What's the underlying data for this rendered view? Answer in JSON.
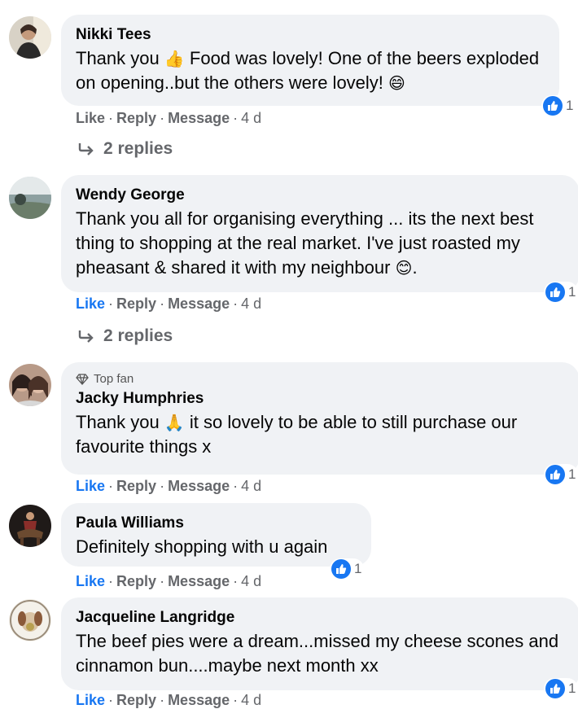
{
  "comments": [
    {
      "name": "Nikki Tees",
      "text_a": "Thank you",
      "emoji_a": "👍",
      "text_b": "Food was lovely! One of the beers exploded on opening..but the others were lovely!",
      "emoji_b": "😄",
      "reactions": "1",
      "like": "Like",
      "reply": "Reply",
      "message": "Message",
      "time": "4 d",
      "replies": "2 replies"
    },
    {
      "name": "Wendy George",
      "text_a": "Thank you all for organising everything ... its the next best thing to shopping at the real market. I've just roasted my pheasant & shared it with my neighbour",
      "emoji_a": "😊",
      "text_b": ".",
      "reactions": "1",
      "like": "Like",
      "reply": "Reply",
      "message": "Message",
      "time": "4 d",
      "replies": "2 replies"
    },
    {
      "badge": "Top fan",
      "name": "Jacky Humphries",
      "text_a": "Thank you",
      "emoji_a": "🙏",
      "text_b": "it so lovely to be able to still purchase our favourite things x",
      "reactions": "1",
      "like": "Like",
      "reply": "Reply",
      "message": "Message",
      "time": "4 d"
    },
    {
      "name": "Paula Williams",
      "text_a": "Definitely shopping with u again",
      "reactions": "1",
      "like": "Like",
      "reply": "Reply",
      "message": "Message",
      "time": "4 d"
    },
    {
      "name": "Jacqueline Langridge",
      "text_a": "The beef pies were a dream...missed my cheese scones and cinnamon bun....maybe next month xx",
      "reactions": "1",
      "like": "Like",
      "reply": "Reply",
      "message": "Message",
      "time": "4 d"
    }
  ],
  "colors": {
    "bubble": "#f0f2f5",
    "accent": "#1877f2",
    "muted": "#65676b"
  },
  "icons": [
    "thumbs-up-reaction-icon",
    "reply-arrow-icon",
    "top-fan-diamond-icon"
  ]
}
